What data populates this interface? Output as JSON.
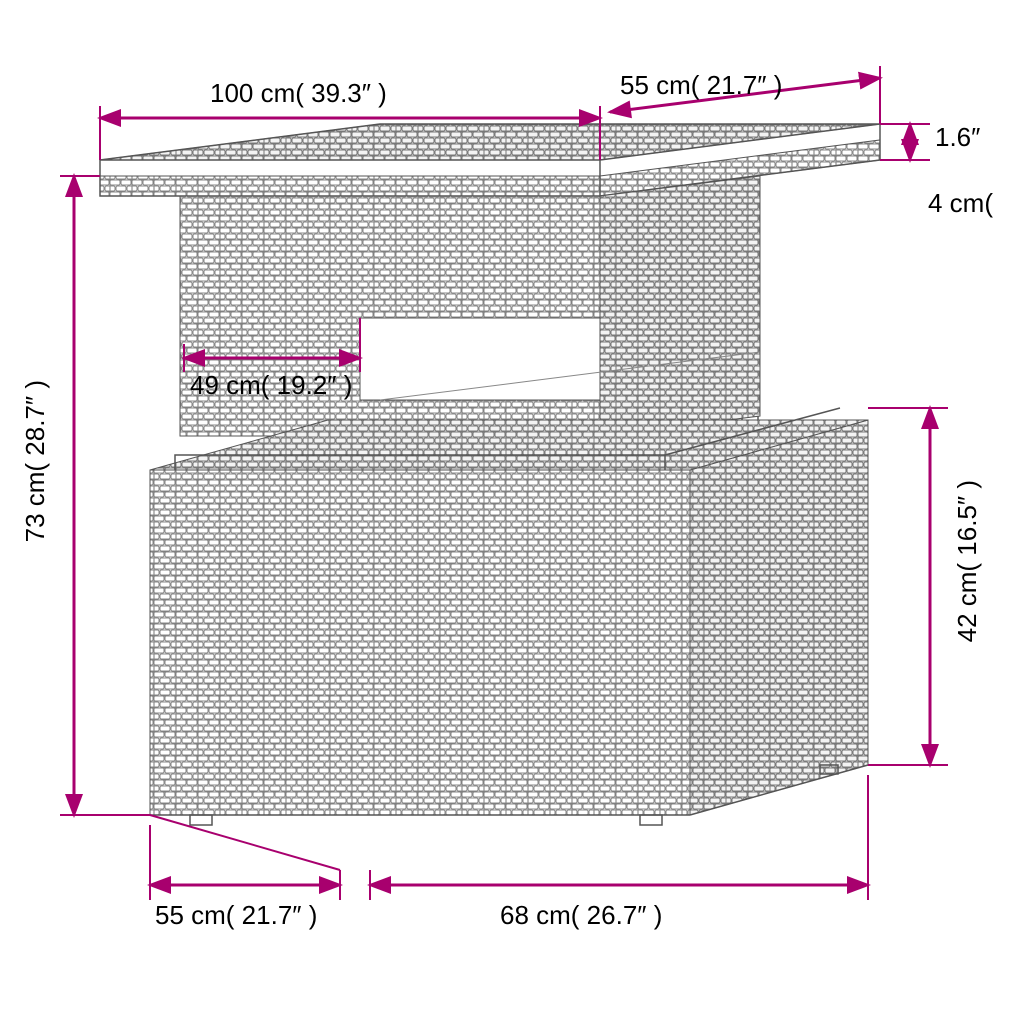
{
  "dimensions": {
    "top_width": "100 cm( 39.3″ )",
    "top_depth": "55 cm( 21.7″ )",
    "edge_thin": "1.6″",
    "top_thickness": "4 cm(",
    "inner_width": "49 cm( 19.2″ )",
    "total_height": "73 cm( 28.7″ )",
    "base_height": "42 cm( 16.5″ )",
    "base_depth": "55 cm( 21.7″ )",
    "base_width": "68 cm( 26.7″ )"
  },
  "colors": {
    "annotation": "#a8006e",
    "lineart": "#6f6f6f",
    "background": "#ffffff"
  },
  "product": {
    "type": "height-adjustable rattan table",
    "material_texture": "woven poly-rattan (brick weave)"
  }
}
